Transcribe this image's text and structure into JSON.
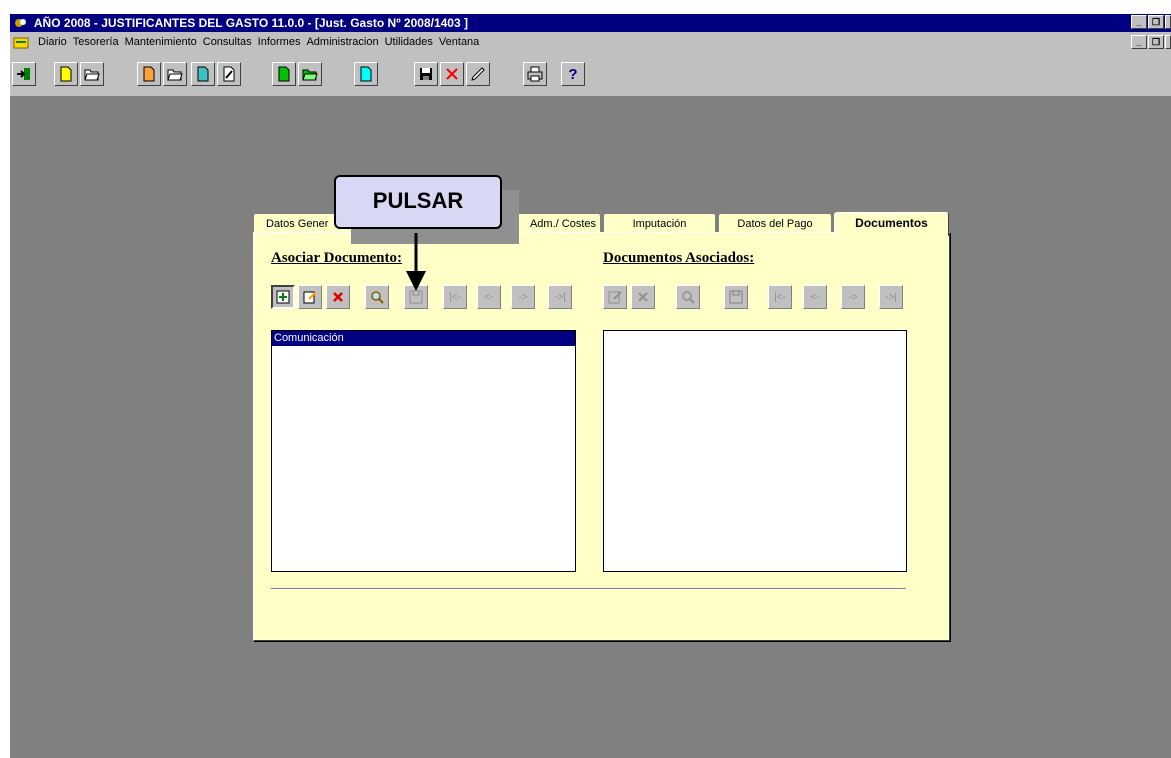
{
  "window": {
    "title": "AÑO 2008 - JUSTIFICANTES DEL GASTO 11.0.0 - [Just. Gasto Nº 2008/1403    ]"
  },
  "menu": {
    "items": [
      "Diario",
      "Tesorería",
      "Mantenimiento",
      "Consultas",
      "Informes",
      "Administracion",
      "Utilidades",
      "Ventana"
    ]
  },
  "toolbar": {
    "help_label": "?"
  },
  "tabs": [
    {
      "label": "Datos Generales",
      "visible_label": "Datos Gener"
    },
    {
      "label": "Adm./ Costes",
      "visible_label": "Adm./ Costes"
    },
    {
      "label": "Imputación",
      "visible_label": "Imputación"
    },
    {
      "label": "Datos del Pago",
      "visible_label": "Datos del Pago"
    },
    {
      "label": "Documentos",
      "visible_label": "Documentos",
      "active": true
    }
  ],
  "asociar": {
    "title": "Asociar Documento:",
    "items": [
      "Comunicación"
    ]
  },
  "asociados": {
    "title": "Documentos Asociados:"
  },
  "nav": {
    "first": "|<-",
    "prev": "<-",
    "next": "->",
    "last": "->|"
  },
  "callout": {
    "text": "PULSAR"
  },
  "colors": {
    "titlebar": "#000080",
    "dialog_bg": "#ffffc8",
    "workspace": "#808080",
    "callout_bg": "#d8d8f4"
  }
}
